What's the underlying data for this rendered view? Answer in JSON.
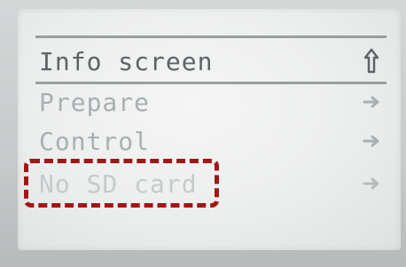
{
  "menu": {
    "title": "Info screen",
    "items": [
      {
        "label": "Prepare",
        "icon": "arrow-right-icon"
      },
      {
        "label": "Control",
        "icon": "arrow-right-icon"
      },
      {
        "label": "No SD card",
        "icon": "arrow-right-icon"
      }
    ],
    "title_icon": "arrow-up-icon"
  },
  "colors": {
    "annotation": "#a31516",
    "lcd_text_title": "#5c6466",
    "lcd_text_item": "#a7b0b2",
    "lcd_rule": "#8a9092"
  }
}
